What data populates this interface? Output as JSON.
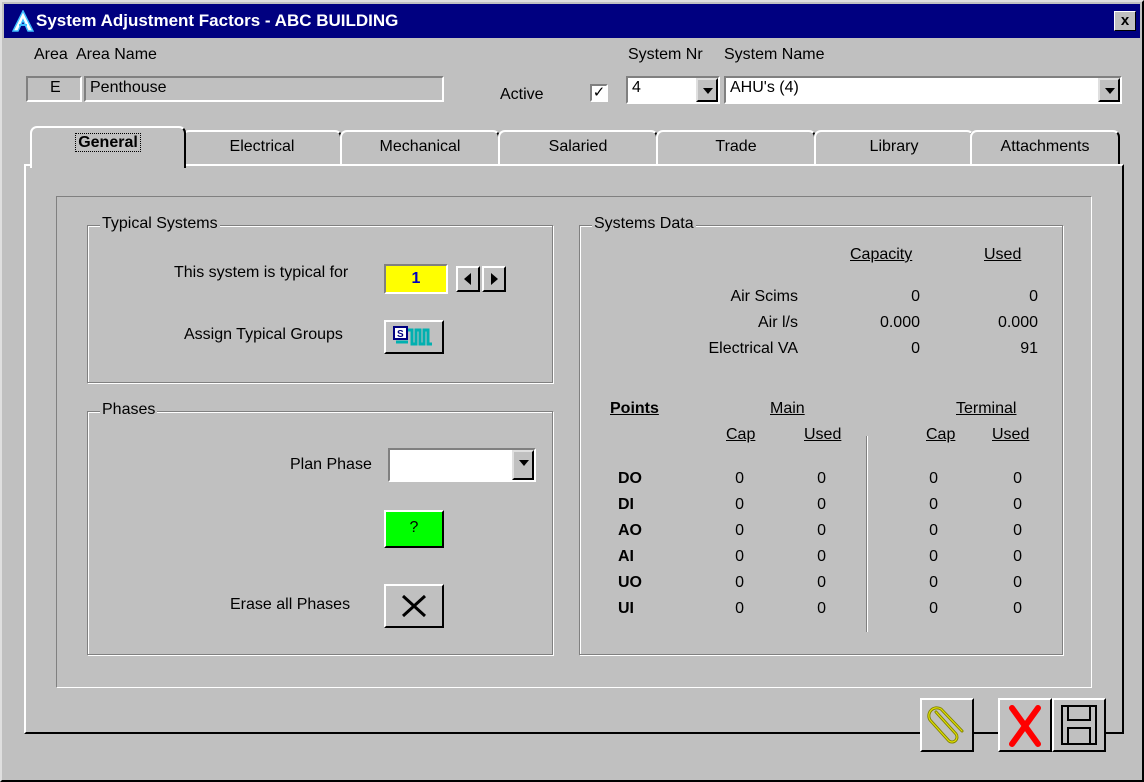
{
  "window": {
    "title": "System Adjustment Factors - ABC BUILDING",
    "close_label": "x"
  },
  "header": {
    "area_label": "Area",
    "area_name_label": "Area Name",
    "area_value": "E",
    "area_name_value": "Penthouse",
    "active_label": "Active",
    "active_checked": true,
    "system_nr_label": "System Nr",
    "system_nr_value": "4",
    "system_name_label": "System Name",
    "system_name_value": "AHU's (4)"
  },
  "tabs": [
    {
      "label": "General",
      "active": true
    },
    {
      "label": "Electrical"
    },
    {
      "label": "Mechanical"
    },
    {
      "label": "Salaried"
    },
    {
      "label": "Trade"
    },
    {
      "label": "Library"
    },
    {
      "label": "Attachments"
    }
  ],
  "typical_systems": {
    "legend": "Typical Systems",
    "typical_for_label": "This system is typical for",
    "typical_for_value": "1",
    "assign_label": "Assign Typical Groups"
  },
  "phases": {
    "legend": "Phases",
    "plan_phase_label": "Plan Phase",
    "plan_phase_value": "",
    "help_label": "?",
    "erase_label": "Erase all Phases"
  },
  "systems_data": {
    "legend": "Systems Data",
    "capacity_header": "Capacity",
    "used_header": "Used",
    "rows": [
      {
        "label": "Air Scims",
        "capacity": "0",
        "used": "0"
      },
      {
        "label": "Air l/s",
        "capacity": "0.000",
        "used": "0.000"
      },
      {
        "label": "Electrical VA",
        "capacity": "0",
        "used": "91"
      }
    ],
    "points_header": "Points",
    "main_header": "Main",
    "terminal_header": "Terminal",
    "cap_header": "Cap",
    "used_sub_header": "Used",
    "points": [
      {
        "name": "DO",
        "main_cap": "0",
        "main_used": "0",
        "term_cap": "0",
        "term_used": "0"
      },
      {
        "name": "DI",
        "main_cap": "0",
        "main_used": "0",
        "term_cap": "0",
        "term_used": "0"
      },
      {
        "name": "AO",
        "main_cap": "0",
        "main_used": "0",
        "term_cap": "0",
        "term_used": "0"
      },
      {
        "name": "AI",
        "main_cap": "0",
        "main_used": "0",
        "term_cap": "0",
        "term_used": "0"
      },
      {
        "name": "UO",
        "main_cap": "0",
        "main_used": "0",
        "term_cap": "0",
        "term_used": "0"
      },
      {
        "name": "UI",
        "main_cap": "0",
        "main_used": "0",
        "term_cap": "0",
        "term_used": "0"
      }
    ]
  },
  "colors": {
    "title_bar": "#000080",
    "typical_field": "#ffff00",
    "typical_text": "#0000c0",
    "help_button": "#00ff00",
    "cancel_x": "#ff0000"
  },
  "icons": [
    "app-icon",
    "close-icon",
    "prev-arrow-icon",
    "next-arrow-icon",
    "assign-groups-icon",
    "erase-x-icon",
    "paperclip-icon",
    "cancel-x-icon",
    "save-disk-icon"
  ]
}
